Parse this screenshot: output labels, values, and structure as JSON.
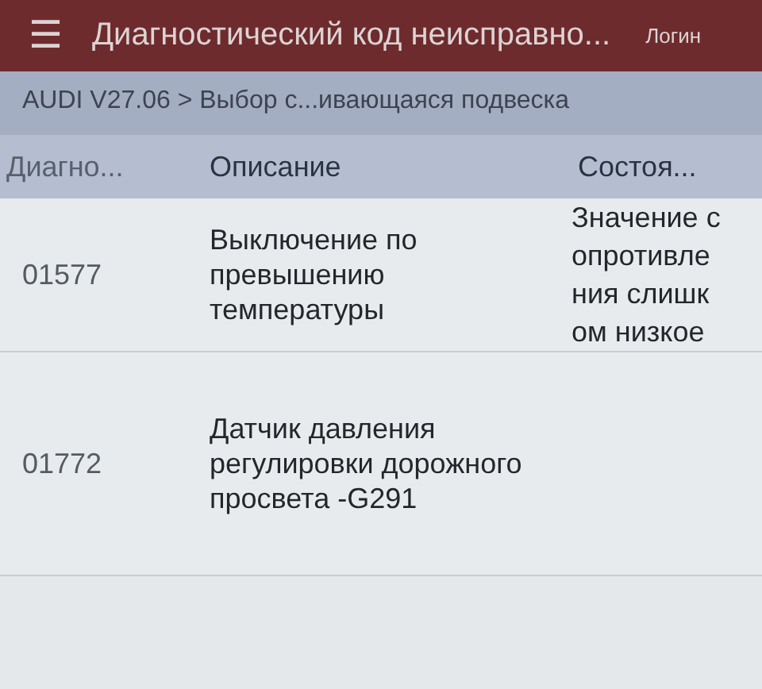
{
  "header": {
    "menu_icon": "☰",
    "title": "Диагностический код неисправно...",
    "login": "Логин"
  },
  "breadcrumb": "AUDI V27.06 > Выбор с...ивающаяся подвеска",
  "table": {
    "columns": [
      "Диагно...",
      "Описание",
      "Состоя..."
    ],
    "rows": [
      {
        "code": "01577",
        "description": "Выключение по превышению температуры",
        "status": "Значение сопротивления слишком низкое"
      },
      {
        "code": "01772",
        "description": "Датчик давления регулировки дорожного просвета -G291",
        "status": ""
      }
    ]
  }
}
